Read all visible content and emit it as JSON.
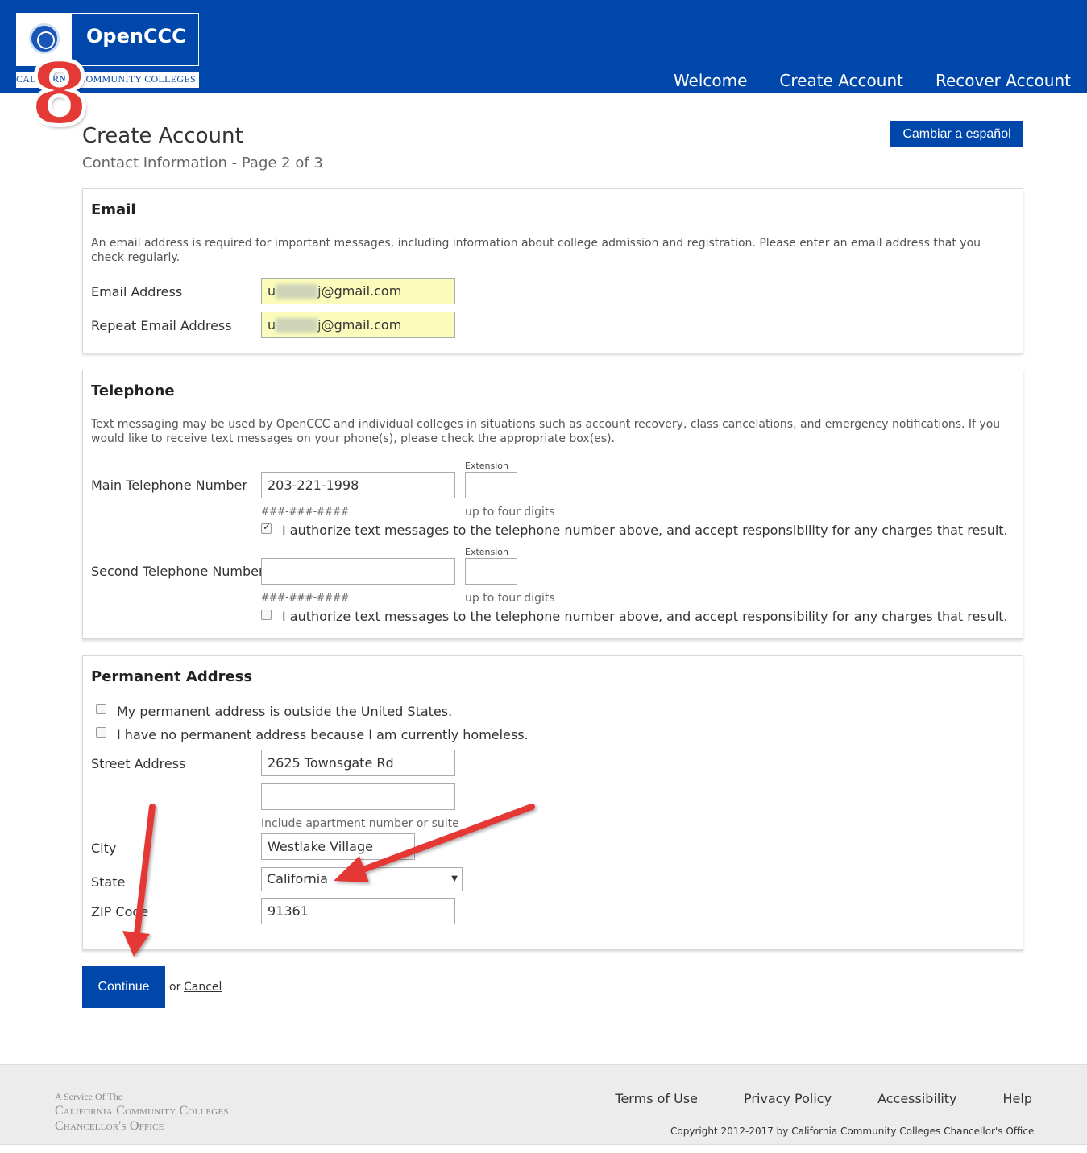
{
  "header": {
    "logo_text": "OpenCCC",
    "logo_subtitle": "CALIFORNIA COMMUNITY COLLEGES",
    "nav": [
      "Welcome",
      "Create Account",
      "Recover Account"
    ]
  },
  "annotation": {
    "step_number": "8"
  },
  "page": {
    "title": "Create Account",
    "subtitle": "Contact Information - Page 2 of 3",
    "language_button": "Cambiar a español"
  },
  "email": {
    "heading": "Email",
    "description": "An email address is required for important messages, including information about college admission and registration. Please enter an email address that you check regularly.",
    "address_label": "Email Address",
    "address_value_prefix": "u",
    "address_value_suffix": "j@gmail.com",
    "repeat_label": "Repeat Email Address",
    "repeat_value_prefix": "u",
    "repeat_value_suffix": "j@gmail.com"
  },
  "telephone": {
    "heading": "Telephone",
    "description": "Text messaging may be used by OpenCCC and individual colleges in situations such as account recovery, class cancelations, and emergency notifications. If you would like to receive text messages on your phone(s), please check the appropriate box(es).",
    "main_label": "Main Telephone Number",
    "main_value": "203-221-1998",
    "main_extension_value": "",
    "second_label": "Second Telephone Number",
    "second_value": "",
    "second_extension_value": "",
    "extension_label": "Extension",
    "format_hint": "###-###-####",
    "extension_hint": "up to four digits",
    "authorize_text": "I authorize text messages to the telephone number above, and accept responsibility for any charges that result.",
    "main_authorized": true,
    "second_authorized": false
  },
  "address": {
    "heading": "Permanent Address",
    "outside_us_text": "My permanent address is outside the United States.",
    "homeless_text": "I have no permanent address because I am currently homeless.",
    "street_label": "Street Address",
    "street_value": "2625 Townsgate Rd",
    "street2_value": "",
    "street_hint": "Include apartment number or suite",
    "city_label": "City",
    "city_value": "Westlake Village",
    "state_label": "State",
    "state_value": "California",
    "zip_label": "ZIP Code",
    "zip_value": "91361"
  },
  "actions": {
    "continue_label": "Continue",
    "or_text": "or",
    "cancel_label": "Cancel"
  },
  "footer": {
    "service_line": "A Service Of The",
    "org_line1": "California Community Colleges",
    "org_line2": "Chancellor's Office",
    "links": [
      "Terms of Use",
      "Privacy Policy",
      "Accessibility",
      "Help"
    ],
    "copyright": "Copyright 2012-2017 by California Community Colleges Chancellor's Office"
  },
  "colors": {
    "brand_blue": "#0047ab",
    "annotation_red": "#e53935",
    "highlight_yellow": "#fbfcbb"
  }
}
